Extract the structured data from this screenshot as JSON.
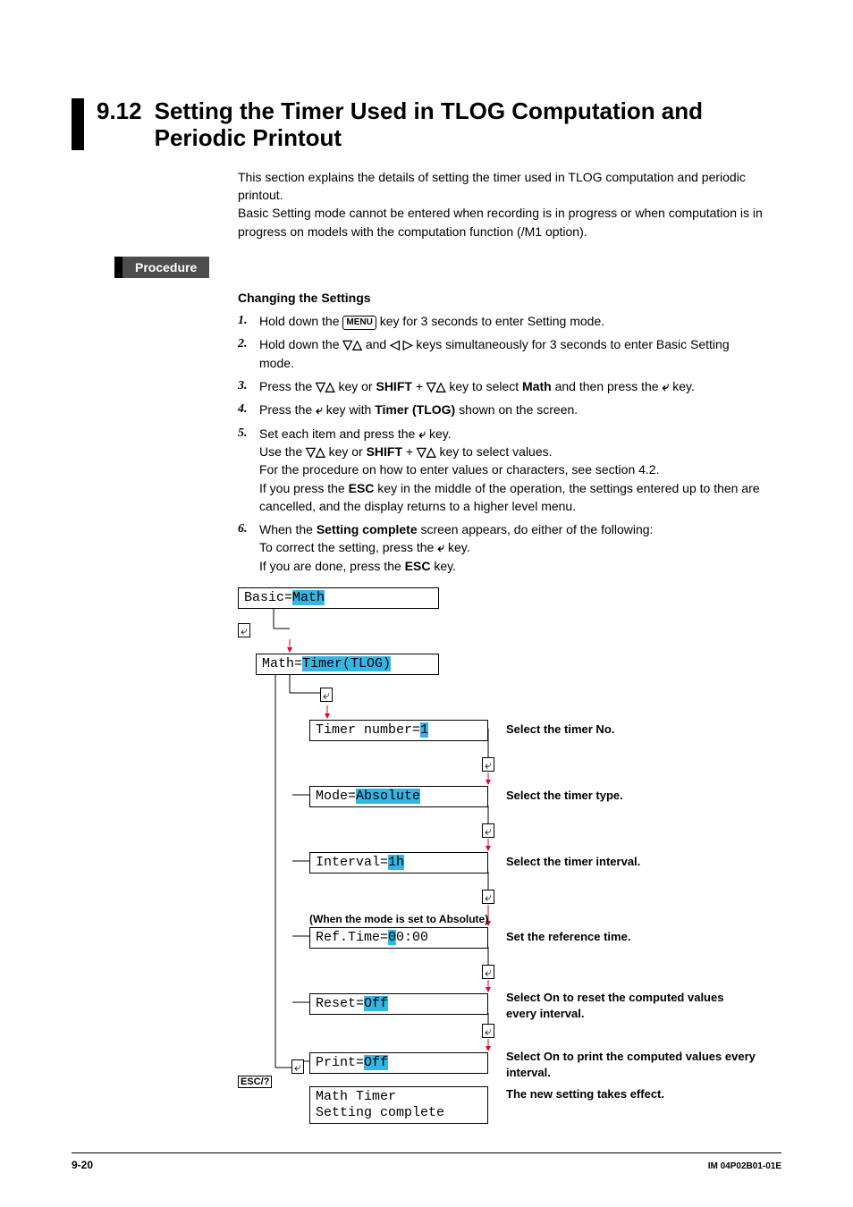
{
  "section": {
    "number": "9.12",
    "title": "Setting the Timer Used in TLOG Computation and Periodic Printout"
  },
  "intro": {
    "p1": "This section explains the details of setting the timer used in TLOG computation and periodic printout.",
    "p2": "Basic Setting mode cannot be entered when recording is in progress or when computation is in progress on models with the computation function (/M1 option)."
  },
  "procedure_label": "Procedure",
  "subhead": "Changing the Settings",
  "keys": {
    "menu": "MENU",
    "esc": "ESC",
    "shift": "SHIFT",
    "math": "Math",
    "timer_tlog": "Timer (TLOG)",
    "setting_complete": "Setting complete",
    "escq": "ESC/?"
  },
  "steps": [
    {
      "n": "1.",
      "pre": "Hold down the ",
      "post": " key for 3 seconds to enter Setting mode."
    },
    {
      "n": "2.",
      "pre": "Hold down the ",
      "mid": " and ",
      "post": " keys simultaneously for 3 seconds to enter Basic Setting mode."
    },
    {
      "n": "3.",
      "a": "Press the ",
      "b": " key or ",
      "c": " + ",
      "d": " key to select ",
      "e": " and then press the ",
      "f": " key."
    },
    {
      "n": "4.",
      "a": "Press the ",
      "b": " key with ",
      "c": " shown on the screen."
    },
    {
      "n": "5.",
      "l1a": "Set each item and press the ",
      "l1b": " key.",
      "l2a": "Use the ",
      "l2b": " key or ",
      "l2c": " + ",
      "l2d": " key to select values.",
      "l3": "For the procedure on how to enter values or characters, see section 4.2.",
      "l4a": "If you press the ",
      "l4b": " key in the middle of the operation, the settings entered up to then are cancelled, and the display returns to a higher level menu."
    },
    {
      "n": "6.",
      "l1a": "When the ",
      "l1b": " screen appears, do either of the following:",
      "l2a": "To correct the setting, press the ",
      "l2b": " key.",
      "l3a": "If you are done, press the ",
      "l3b": " key."
    }
  ],
  "diagram": {
    "basic": {
      "label": "Basic=",
      "val": "Math"
    },
    "math": {
      "label": "Math=",
      "val": "Timer(TLOG)"
    },
    "timer": {
      "label": "Timer number=",
      "val": "1",
      "desc": "Select the timer No."
    },
    "mode": {
      "label": "Mode=",
      "val": "Absolute",
      "desc": "Select the timer type."
    },
    "interval": {
      "label": "Interval=",
      "val": "1h",
      "desc": "Select the timer interval."
    },
    "reftime": {
      "label": "Ref.Time=",
      "v1": "0",
      "v2": "0:00",
      "desc": "Set the reference time.",
      "note": "(When the mode is set to Absolute)"
    },
    "reset": {
      "label": "Reset=",
      "val": "Off",
      "desc": "Select On to reset the computed values every interval."
    },
    "print": {
      "label": "Print=",
      "val": "Off",
      "desc": "Select On to print the computed values every interval."
    },
    "complete": {
      "l1": "Math Timer",
      "l2": "Setting complete",
      "desc": "The new setting takes effect."
    },
    "enter_glyph": "⤶"
  },
  "footer": {
    "page": "9-20",
    "docid": "IM 04P02B01-01E"
  }
}
